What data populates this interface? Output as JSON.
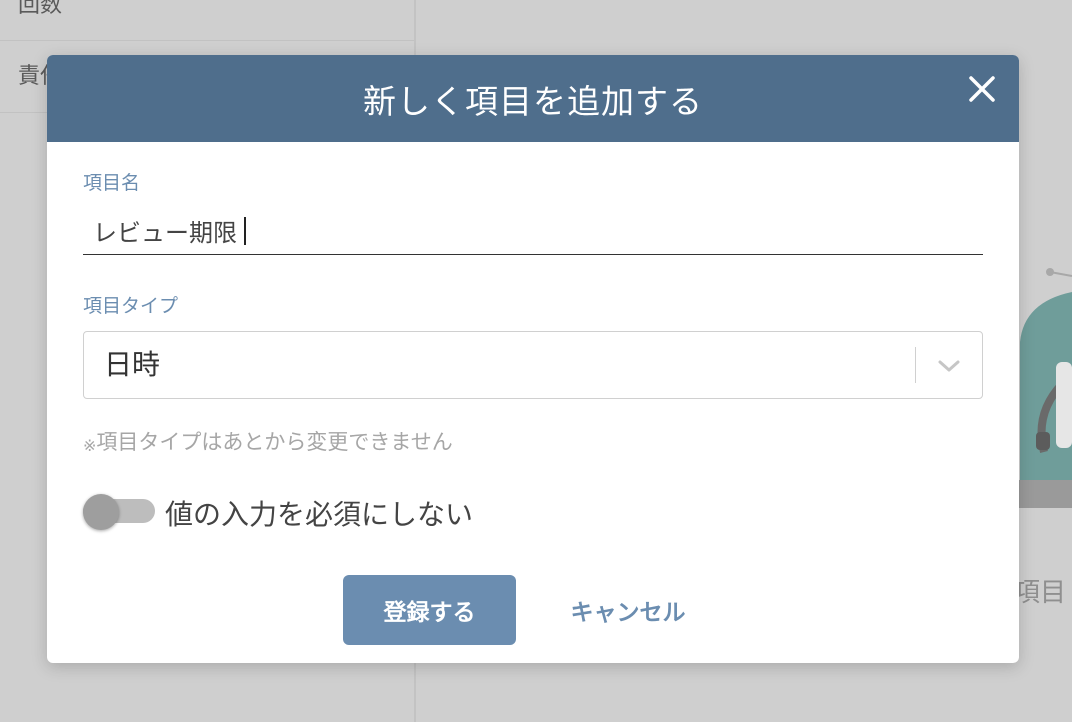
{
  "background": {
    "rows": [
      {
        "label": "回数"
      },
      {
        "label": "責任"
      }
    ],
    "side_text": "項目"
  },
  "modal": {
    "title": "新しく項目を追加する",
    "close_icon": "close-icon",
    "name_field": {
      "label": "項目名",
      "value": "レビュー期限"
    },
    "type_field": {
      "label": "項目タイプ",
      "selected": "日時",
      "arrow_icon": "chevron-down-icon"
    },
    "note": {
      "mark": "※",
      "text": "項目タイプはあとから変更できません"
    },
    "required_toggle": {
      "label": "値の入力を必須にしない",
      "on": false
    },
    "buttons": {
      "submit": "登録する",
      "cancel": "キャンセル"
    }
  },
  "colors": {
    "header": "#4f6e8c",
    "accent": "#6b8db0",
    "overlay": "#cfcfcf"
  }
}
